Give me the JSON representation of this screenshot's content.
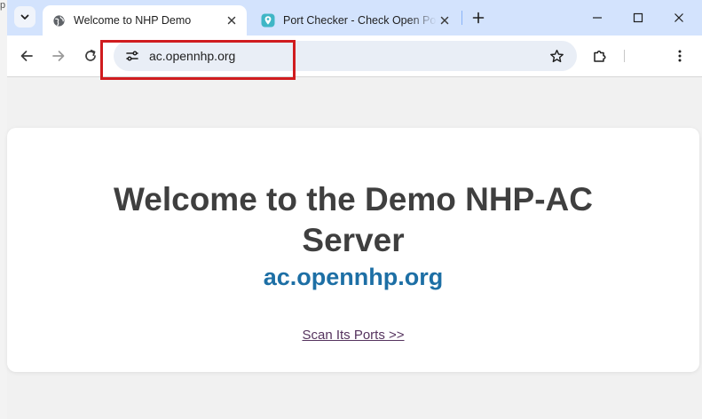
{
  "window": {
    "edge_text": "p"
  },
  "tabs": [
    {
      "title": "Welcome to NHP Demo",
      "active": true,
      "favicon": "globe-icon"
    },
    {
      "title": "Port Checker - Check Open Ports",
      "active": false,
      "favicon": "map-pin-icon"
    }
  ],
  "toolbar": {
    "url": "ac.opennhp.org"
  },
  "page": {
    "heading": "Welcome to the Demo NHP-AC Server",
    "domain": "ac.opennhp.org",
    "link_text": "Scan Its Ports >>"
  },
  "colors": {
    "tab_strip": "#d3e3fd",
    "omnibox": "#e9eef6",
    "highlight_box": "#d01c1f",
    "heading_text": "#3f3f3f",
    "domain_text": "#1d6fa5",
    "link_text": "#55335e",
    "page_background": "#f1f1f1"
  }
}
